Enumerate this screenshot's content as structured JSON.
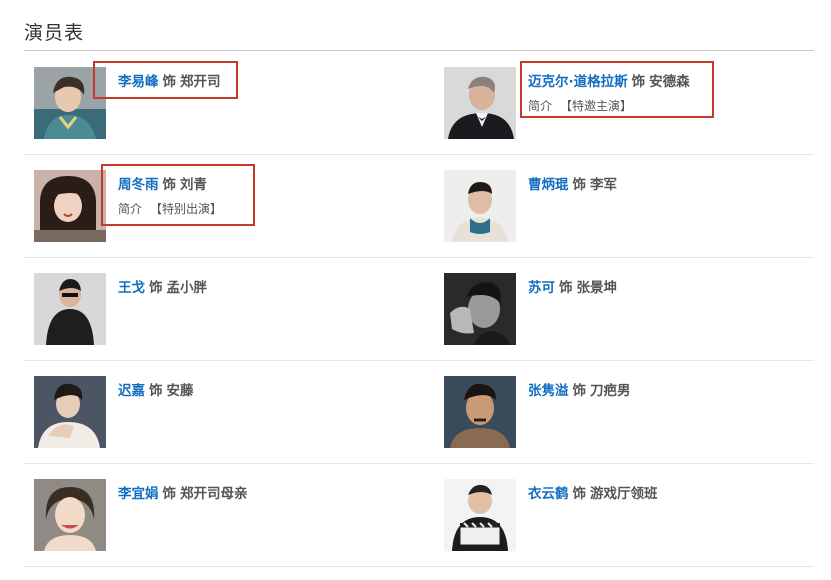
{
  "section": {
    "title": "演员表"
  },
  "cast": [
    {
      "actor": "李易峰",
      "sep": "饰",
      "role": "郑开司",
      "intro": "",
      "tag": ""
    },
    {
      "actor": "迈克尔·道格拉斯",
      "sep": "饰",
      "role": "安德森",
      "intro": "简介",
      "tag": "【特邀主演】"
    },
    {
      "actor": "周冬雨",
      "sep": "饰",
      "role": "刘青",
      "intro": "简介",
      "tag": "【特别出演】"
    },
    {
      "actor": "曹炳琨",
      "sep": "饰",
      "role": "李军",
      "intro": "",
      "tag": ""
    },
    {
      "actor": "王戈",
      "sep": "饰",
      "role": "孟小胖",
      "intro": "",
      "tag": ""
    },
    {
      "actor": "苏可",
      "sep": "饰",
      "role": "张景坤",
      "intro": "",
      "tag": ""
    },
    {
      "actor": "迟嘉",
      "sep": "饰",
      "role": "安藤",
      "intro": "",
      "tag": ""
    },
    {
      "actor": "张隽溢",
      "sep": "饰",
      "role": "刀疤男",
      "intro": "",
      "tag": ""
    },
    {
      "actor": "李宜娟",
      "sep": "饰",
      "role": "郑开司母亲",
      "intro": "",
      "tag": ""
    },
    {
      "actor": "衣云鹤",
      "sep": "饰",
      "role": "游戏厅领班",
      "intro": "",
      "tag": ""
    }
  ],
  "colors": {
    "link": "#136ec2",
    "text": "#555555",
    "highlight": "#c5392c"
  }
}
